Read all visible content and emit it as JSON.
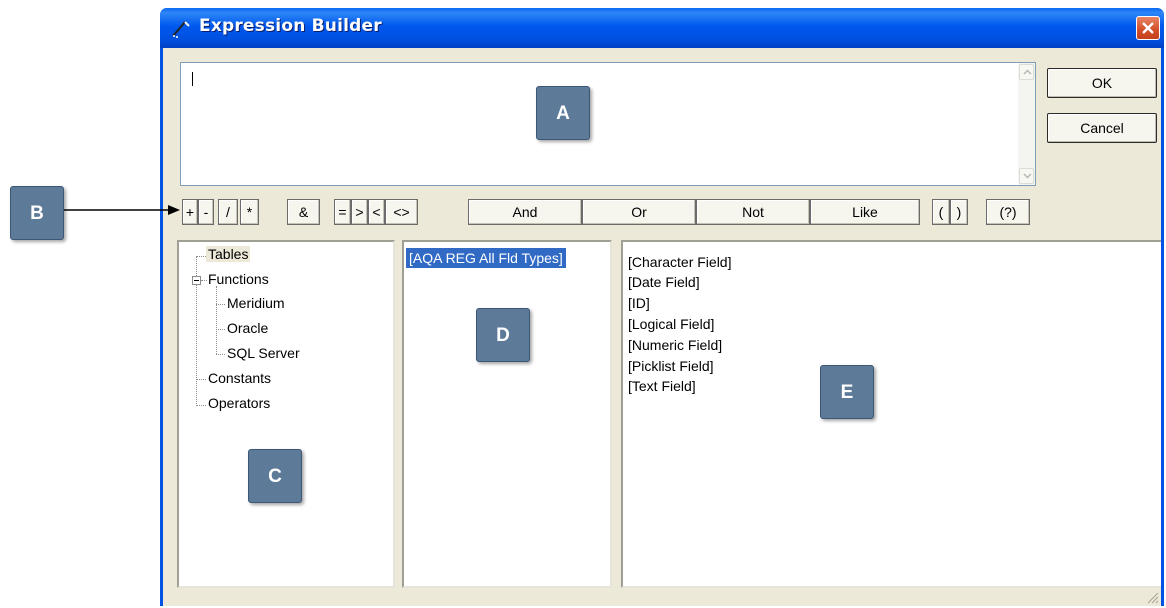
{
  "window": {
    "title": "Expression Builder"
  },
  "expression": {
    "value": ""
  },
  "buttons": {
    "ok": "OK",
    "cancel": "Cancel"
  },
  "operators": [
    "+",
    "-",
    "/",
    "*",
    "&",
    "=",
    ">",
    "<",
    "<>",
    "And",
    "Or",
    "Not",
    "Like",
    "(",
    ")",
    "(?)"
  ],
  "tree": {
    "tables": "Tables",
    "functions": "Functions",
    "meridium": "Meridium",
    "oracle": "Oracle",
    "sql_server": "SQL Server",
    "constants": "Constants",
    "operators": "Operators"
  },
  "tables_list": [
    "[AQA REG All Fld Types]"
  ],
  "fields_list": [
    "[Character Field]",
    "[Date Field]",
    "[ID]",
    "[Logical Field]",
    "[Numeric Field]",
    "[Picklist Field]",
    "[Text Field]"
  ],
  "callouts": {
    "a": "A",
    "b": "B",
    "c": "C",
    "d": "D",
    "e": "E"
  },
  "colors": {
    "titlebar": "#0054e3",
    "selection": "#316ac5",
    "callout": "#5d7a99",
    "dialog_bg": "#ece9d8"
  }
}
